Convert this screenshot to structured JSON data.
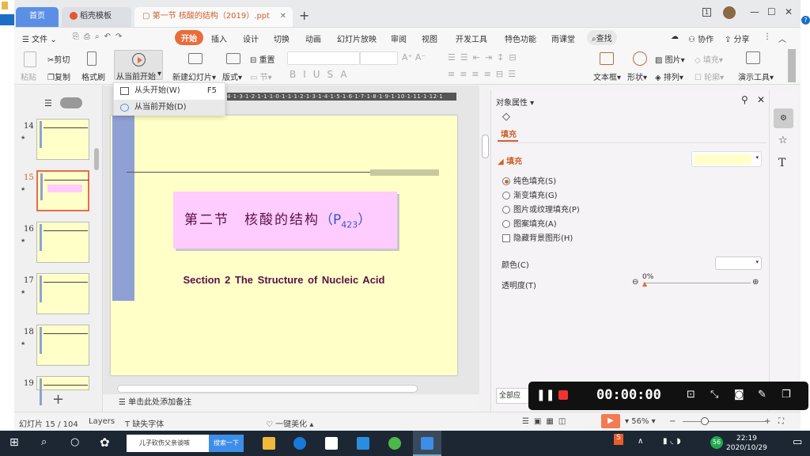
{
  "window": {
    "tabs": [
      {
        "label": "首页"
      },
      {
        "label": "稻壳模板"
      },
      {
        "label": "第一节 核酸的结构（2019）.ppt"
      }
    ],
    "badge": "1"
  },
  "menu": {
    "items": [
      "文件",
      "开始",
      "插入",
      "设计",
      "切换",
      "动画",
      "幻灯片放映",
      "审阅",
      "视图",
      "开发工具",
      "特色功能",
      "雨课堂"
    ],
    "search": "查找",
    "collab": "协作",
    "share": "分享"
  },
  "ribbon": {
    "paste": "粘贴",
    "cut": "剪切",
    "copy": "复制",
    "format_painter": "格式刷",
    "play_from_current": "从当前开始",
    "new_slide": "新建幻灯片",
    "layout": "版式",
    "reset": "重置",
    "section": "节",
    "textbox": "文本框",
    "shape": "形状",
    "picture": "图片",
    "fill": "填充",
    "arrange": "排列",
    "outline": "轮廓",
    "presenter_tools": "演示工具"
  },
  "dropdown": {
    "items": [
      {
        "label": "从头开始(W)",
        "shortcut": "F5"
      },
      {
        "label": "从当前开始(D)",
        "shortcut": ""
      }
    ]
  },
  "thumbnails": [
    {
      "num": "14"
    },
    {
      "num": "15",
      "selected": true
    },
    {
      "num": "16"
    },
    {
      "num": "17"
    },
    {
      "num": "18"
    },
    {
      "num": "19"
    }
  ],
  "ruler": "4·1·3·1·2·1·1·1·0·1·1·1·2·1·3·1·4·1·5·1·6·1·7·1·8·1·9·1·10·1·11·1·12·1",
  "slide": {
    "title_cn": "第二节　核酸的结构",
    "title_p": "（P",
    "title_sub": "423",
    "title_end": "）",
    "subtitle": "Section 2    The Structure of Nucleic Acid",
    "colors": {
      "background": "#ffffc8",
      "title_box": "#ffccff",
      "accent_bar": "#8fa1d4"
    }
  },
  "notes_placeholder": "单击此处添加备注",
  "pane": {
    "header": "对象属性",
    "tab": "填充",
    "section": "填充",
    "fill_color": "#ffffc8",
    "options": [
      "纯色填充(S)",
      "渐变填充(G)",
      "图片或纹理填充(P)",
      "图案填充(A)"
    ],
    "selected_option": 0,
    "hide_bg": "隐藏背景图形(H)",
    "color_label": "颜色(C)",
    "transparency_label": "透明度(T)",
    "transparency_value": "0%",
    "apply_all": "全部应"
  },
  "status": {
    "slide_count": "幻灯片 15 / 104",
    "layers": "Layers",
    "missing_font": "缺失字体",
    "beautify": "一键美化",
    "zoom": "56%"
  },
  "recorder": {
    "time": "00:00:00"
  },
  "taskbar": {
    "search_text": "儿子砍伤父亲谈咳",
    "search_btn": "搜索一下",
    "time": "22:19",
    "date": "2020/10/29",
    "badge": "56"
  }
}
